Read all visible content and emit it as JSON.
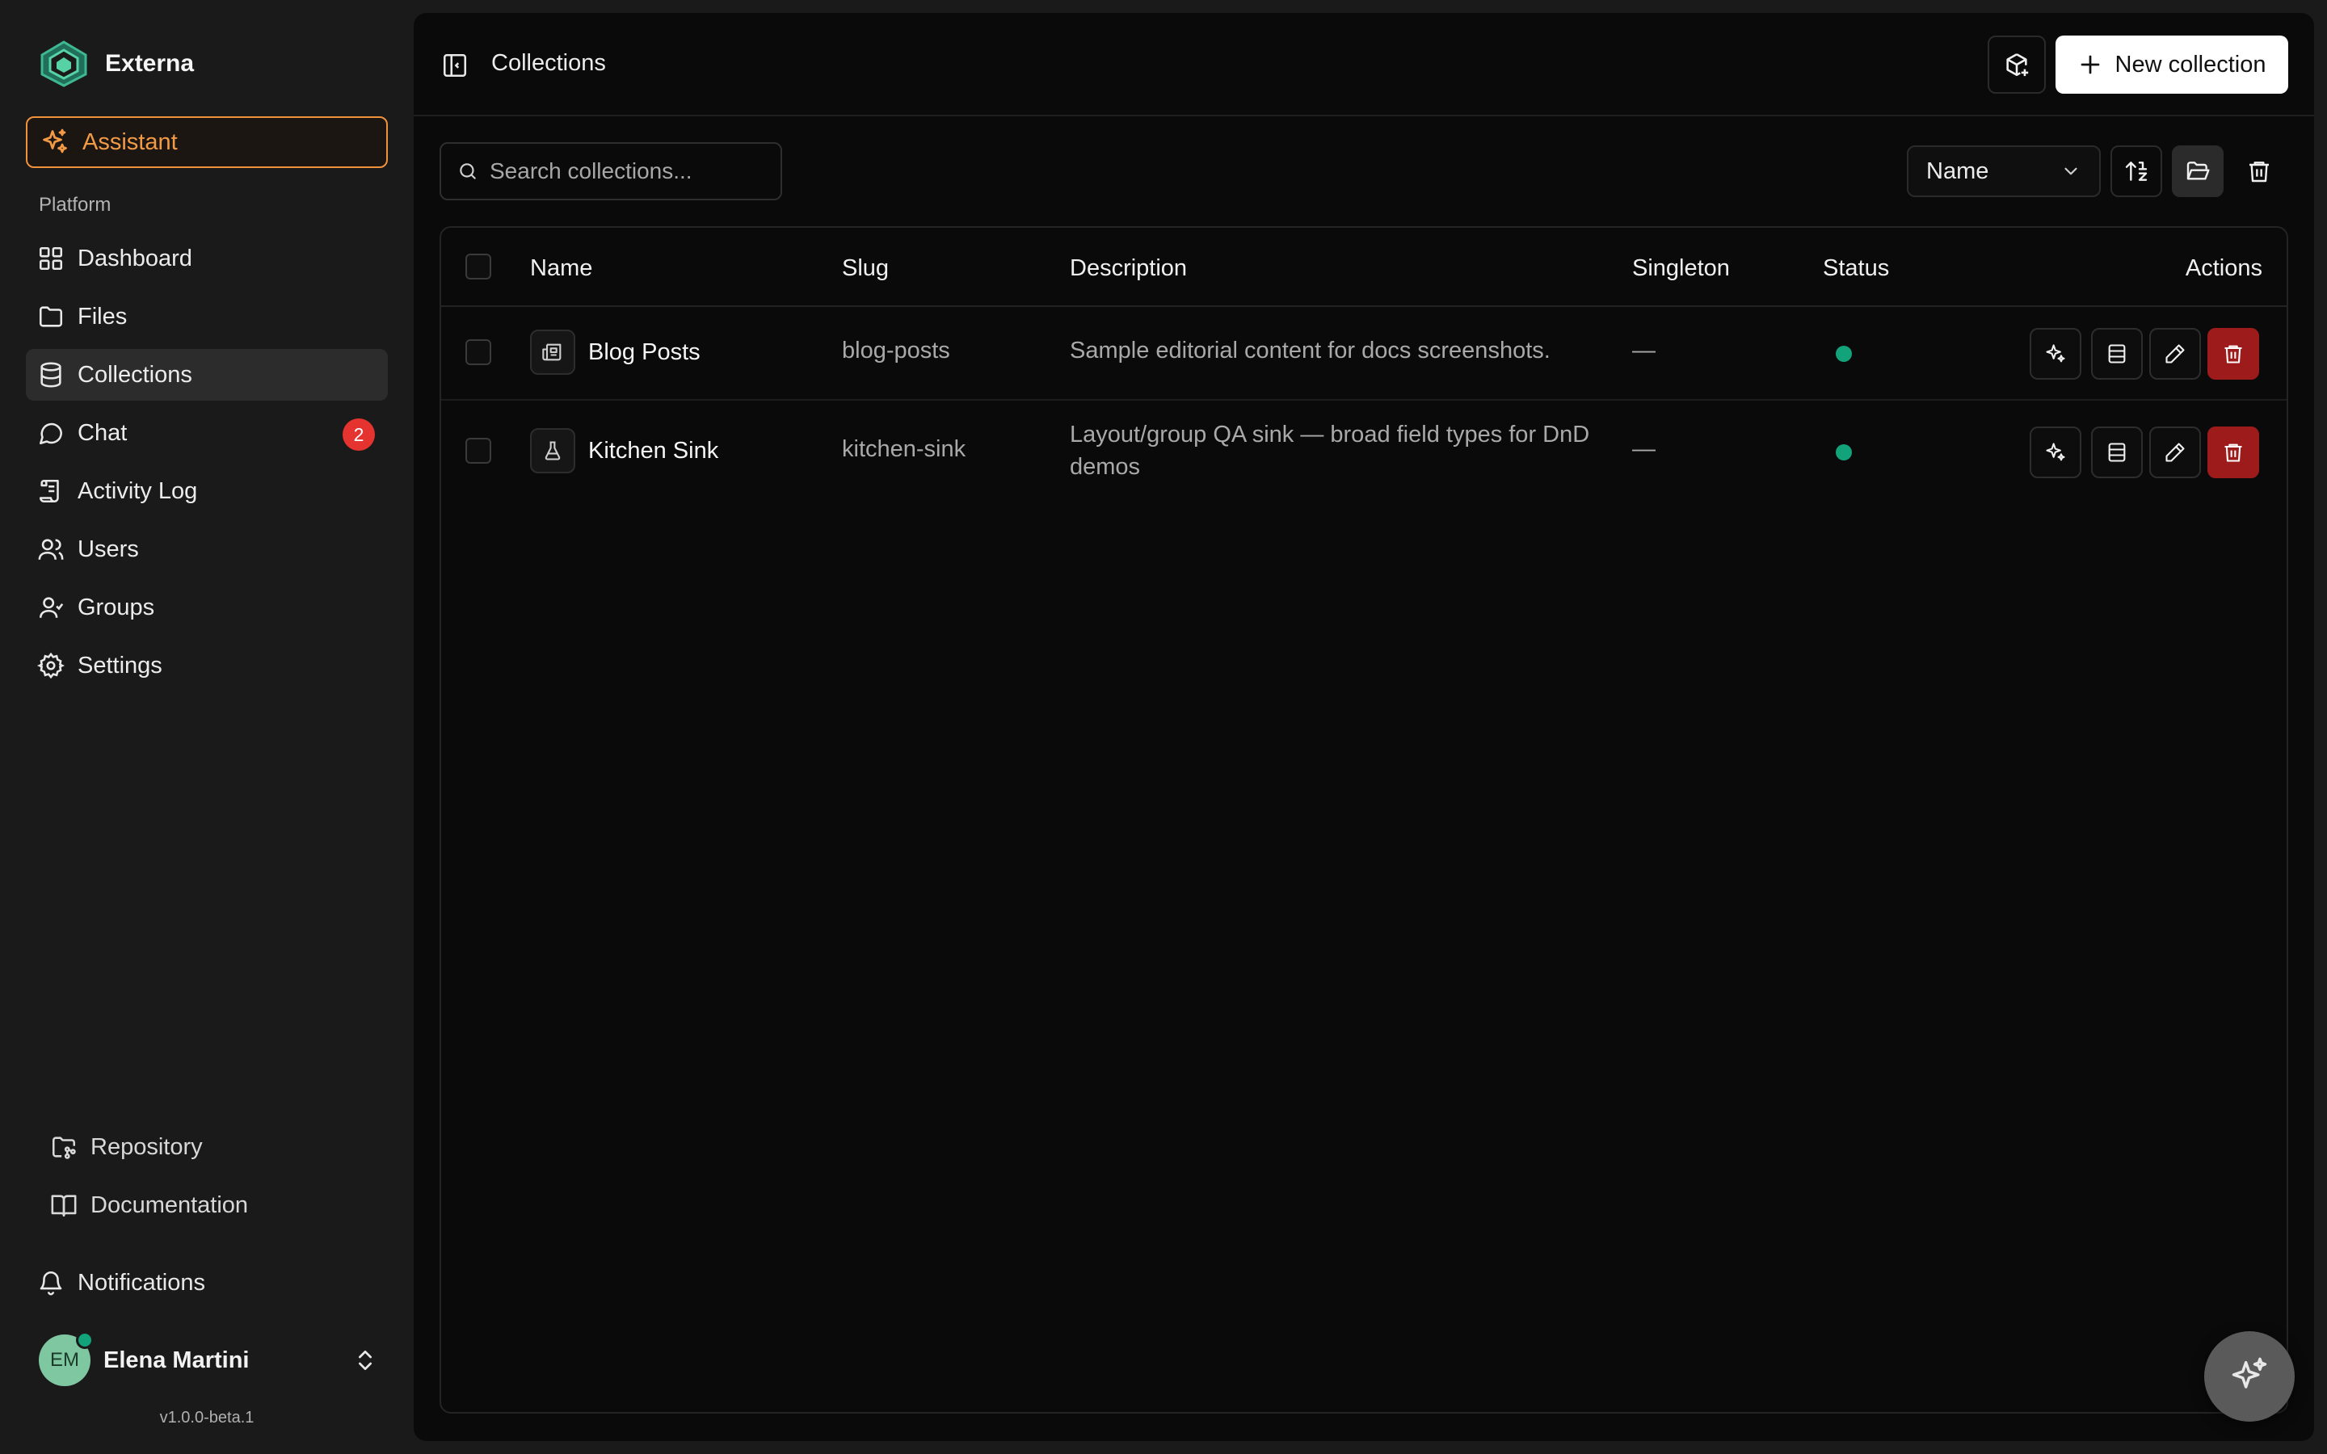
{
  "app": {
    "name": "Externa",
    "version": "v1.0.0-beta.1"
  },
  "sidebar": {
    "assistant_label": "Assistant",
    "section_label": "Platform",
    "items": [
      {
        "label": "Dashboard",
        "icon": "dashboard-icon"
      },
      {
        "label": "Files",
        "icon": "folder-icon"
      },
      {
        "label": "Collections",
        "icon": "database-icon",
        "active": true
      },
      {
        "label": "Chat",
        "icon": "chat-icon",
        "badge": "2"
      },
      {
        "label": "Activity Log",
        "icon": "scroll-icon"
      },
      {
        "label": "Users",
        "icon": "users-icon"
      },
      {
        "label": "Groups",
        "icon": "groups-icon"
      },
      {
        "label": "Settings",
        "icon": "gear-icon"
      }
    ],
    "bottom_links": [
      {
        "label": "Repository",
        "icon": "repository-icon"
      },
      {
        "label": "Documentation",
        "icon": "book-icon"
      }
    ],
    "notifications_label": "Notifications",
    "user": {
      "initials": "EM",
      "name": "Elena Martini"
    }
  },
  "header": {
    "title": "Collections",
    "new_button_label": "New collection"
  },
  "toolbar": {
    "search_placeholder": "Search collections...",
    "sort_value": "Name"
  },
  "table": {
    "columns": [
      "Name",
      "Slug",
      "Description",
      "Singleton",
      "Status",
      "Actions"
    ],
    "rows": [
      {
        "name": "Blog Posts",
        "icon": "newspaper-icon",
        "slug": "blog-posts",
        "description": "Sample editorial content for docs screenshots.",
        "singleton": "—",
        "status": "active"
      },
      {
        "name": "Kitchen Sink",
        "icon": "flask-icon",
        "slug": "kitchen-sink",
        "description": "Layout/group QA sink — broad field types for DnD demos",
        "singleton": "—",
        "status": "active"
      }
    ]
  },
  "colors": {
    "accent": "#f0913c",
    "status_active": "#12a37a",
    "danger": "#9e1b1b",
    "badge": "#e5342f"
  }
}
